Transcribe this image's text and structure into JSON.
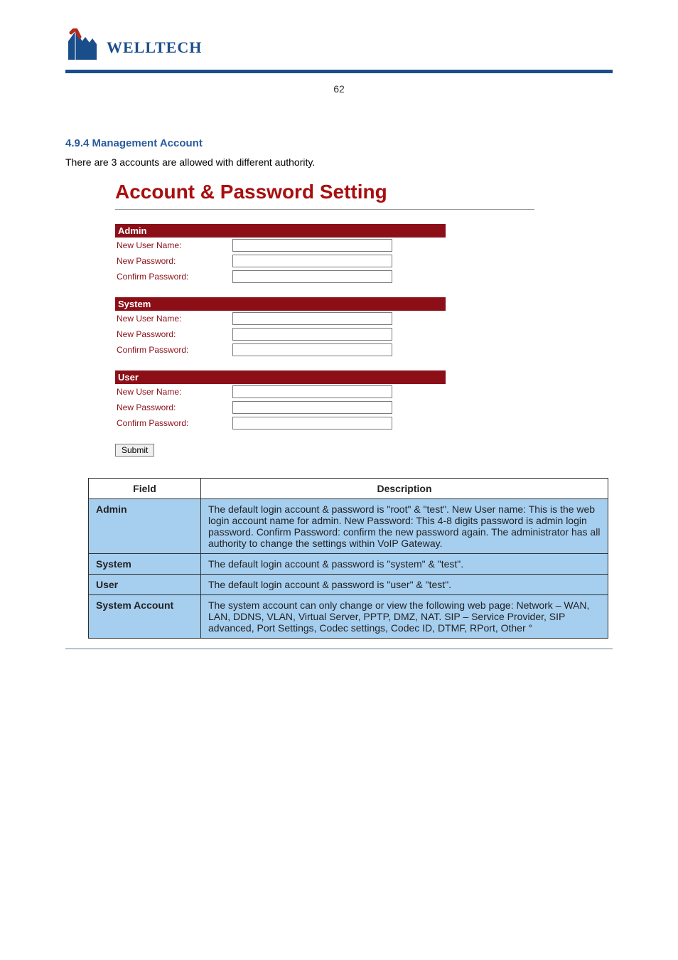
{
  "logo_text": "WELLTECH",
  "page_number_top": "62",
  "form": {
    "title": "Account & Password Setting",
    "sections": [
      {
        "key": "admin",
        "heading": "Admin",
        "rows": [
          "New User Name:",
          "New Password:",
          "Confirm Password:"
        ]
      },
      {
        "key": "system",
        "heading": "System",
        "rows": [
          "New User Name:",
          "New Password:",
          "Confirm Password:"
        ]
      },
      {
        "key": "user",
        "heading": "User",
        "rows": [
          "New User Name:",
          "New Password:",
          "Confirm Password:"
        ]
      }
    ],
    "submit_label": "Submit"
  },
  "table": {
    "head_field": "Field",
    "head_desc": "Description",
    "rows": [
      {
        "field": "Admin",
        "desc": "The default login account & password is \"root\" & \"test\". New User name: This is the web login account name for admin. New Password: This 4-8 digits password is admin login password. Confirm Password: confirm the new password again. The administrator has all authority to change the settings within VoIP Gateway."
      },
      {
        "field": "System",
        "desc": "The default login account & password is \"system\" & \"test\"."
      },
      {
        "field": "User",
        "desc": "The default login account & password is \"user\" & \"test\"."
      },
      {
        "field": "System Account",
        "desc": "The system account can only change or view the following web page: Network – WAN, LAN, DDNS, VLAN, Virtual Server, PPTP, DMZ, NAT. SIP – Service Provider, SIP advanced, Port Settings, Codec settings, Codec ID, DTMF, RPort, Other ° "
      }
    ]
  },
  "page_heading": "4.9.4 Management Account",
  "page_intro": "There are 3 accounts are allowed with different authority."
}
